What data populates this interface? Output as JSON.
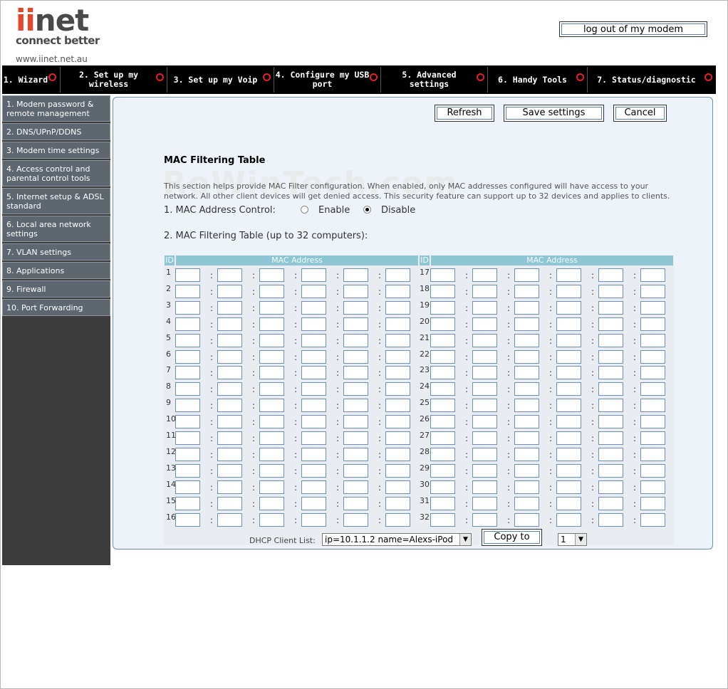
{
  "header": {
    "brand": "iinet",
    "tagline": "connect better",
    "url": "www.iinet.net.au",
    "logout_label": "log out of my modem"
  },
  "topnav": [
    {
      "label": "1. Wizard"
    },
    {
      "label": "2. Set up my wireless"
    },
    {
      "label": "3. Set up my Voip"
    },
    {
      "label": "4. Configure my USB port"
    },
    {
      "label": "5. Advanced settings"
    },
    {
      "label": "6. Handy Tools"
    },
    {
      "label": "7. Status/diagnostic"
    }
  ],
  "sidebar": [
    {
      "label": "1. Modem password & remote management"
    },
    {
      "label": "2. DNS/UPnP/DDNS"
    },
    {
      "label": "3. Modem time settings"
    },
    {
      "label": "4. Access control and parental control tools"
    },
    {
      "label": "5. Internet setup & ADSL standard"
    },
    {
      "label": "6. Local area network settings"
    },
    {
      "label": "7. VLAN settings"
    },
    {
      "label": "8. Applications"
    },
    {
      "label": "9. Firewall"
    },
    {
      "label": "10. Port Forwarding"
    }
  ],
  "actions": {
    "refresh": "Refresh",
    "save": "Save settings",
    "cancel": "Cancel"
  },
  "content": {
    "title": "MAC Filtering Table",
    "watermark": "RoWinTech.com",
    "description": "This section helps provide MAC Filter configuration. When enabled, only MAC addresses configured will have access to your network. All other client devices will get denied access. This security feature can support up to 32 devices and applies to clients.",
    "mac_control_label": "1. MAC Address Control:",
    "enable_label": "Enable",
    "disable_label": "Disable",
    "mac_control_selected": "Disable",
    "table_label": "2. MAC Filtering Table (up to 32 computers):",
    "id_header": "ID",
    "mac_header": "MAC Address",
    "dhcp_label": "DHCP Client List:",
    "dhcp_selected": "ip=10.1.1.2 name=Alexs-iPod",
    "copy_label": "Copy to",
    "copy_target": "1"
  },
  "colors": {
    "accent_red": "#e8202a",
    "brand_red": "#e3462b",
    "table_header": "#8ec7d3",
    "sidebar_item": "#5e666f",
    "panel_border": "#6f8fb5"
  }
}
